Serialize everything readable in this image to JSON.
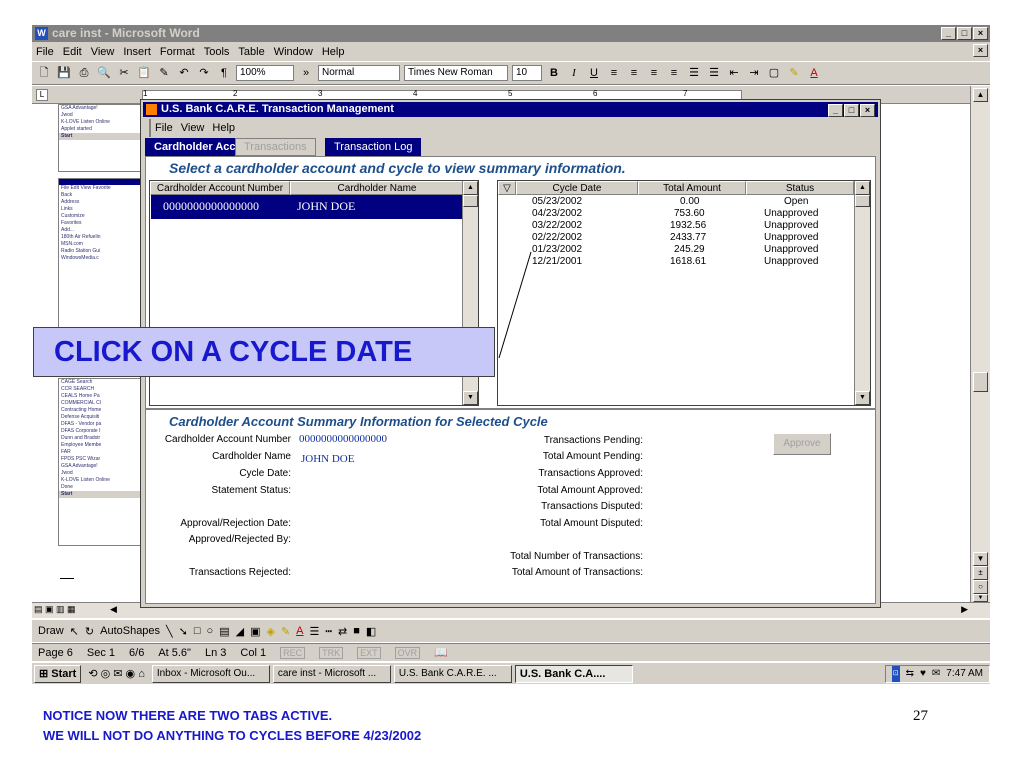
{
  "word": {
    "title": "care inst - Microsoft Word",
    "menu": [
      "File",
      "Edit",
      "View",
      "Insert",
      "Format",
      "Tools",
      "Table",
      "Window",
      "Help"
    ],
    "zoom": "100%",
    "style": "Normal",
    "font": "Times New Roman",
    "font_size": "10",
    "ruler_numbers": [
      "1",
      "2",
      "3",
      "4",
      "5",
      "6",
      "7"
    ],
    "drawbar": {
      "draw": "Draw",
      "autoshapes": "AutoShapes"
    },
    "status": {
      "page": "Page 6",
      "sec": "Sec 1",
      "pages": "6/6",
      "at": "At 5.6\"",
      "ln": "Ln 3",
      "col": "Col 1",
      "rec": "REC",
      "trk": "TRK",
      "ext": "EXT",
      "ovr": "OVR"
    }
  },
  "taskbar": {
    "start": "Start",
    "buttons": [
      "Inbox - Microsoft Ou...",
      "care inst - Microsoft ...",
      "U.S. Bank C.A.R.E. ...",
      "U.S. Bank C.A...."
    ],
    "clock": "7:47 AM"
  },
  "left_thumbs": {
    "top_items": [
      "GSA Advantage!",
      "Jwod",
      "K-LOVE Listen Online",
      "Applet started"
    ],
    "browser_menu": [
      "File",
      "Edit",
      "View",
      "Favorite"
    ],
    "nav": [
      "Back",
      "Address",
      "Links",
      "Customize",
      "Favorites",
      "Add...",
      "Orga"
    ],
    "links": [
      "180th Air Refuelin",
      "MSN.com",
      "Radio Station Gui",
      "WindowsMedia.c"
    ],
    "bottom_items": [
      "CAGE Search",
      "CCR SEARCH",
      "CEALS Home Pa",
      "COMMERCIAL Cl",
      "Contracting Home",
      "Defense Acquisiti",
      "DFAS - Vendor pa",
      "DFAS Corporate I",
      "Dunn and Bradstr",
      "Employee Membe",
      "FAR",
      "FPDS PSC Wizar",
      "GSA Advantage!",
      "Jwod",
      "K-LOVE Listen Online",
      "Done"
    ]
  },
  "app": {
    "title": "U.S. Bank C.A.R.E. Transaction Management",
    "menu": [
      "File",
      "View",
      "Help"
    ],
    "tabs": [
      "Cardholder Accts",
      "Transactions",
      "Transaction Log"
    ],
    "instruction": "Select a cardholder account and cycle to view summary information.",
    "accounts": {
      "headers": [
        "Cardholder Account Number",
        "Cardholder Name"
      ],
      "rows": [
        [
          "0000000000000000",
          "JOHN DOE"
        ]
      ]
    },
    "cycles": {
      "headers": [
        "Cycle Date",
        "Total Amount",
        "Status"
      ],
      "rows": [
        [
          "05/23/2002",
          "0.00",
          "Open"
        ],
        [
          "04/23/2002",
          "753.60",
          "Unapproved"
        ],
        [
          "03/22/2002",
          "1932.56",
          "Unapproved"
        ],
        [
          "02/22/2002",
          "2433.77",
          "Unapproved"
        ],
        [
          "01/23/2002",
          "245.29",
          "Unapproved"
        ],
        [
          "12/21/2001",
          "1618.61",
          "Unapproved"
        ]
      ]
    },
    "summary": {
      "title": "Cardholder Account Summary Information for Selected Cycle",
      "left_labels": [
        "Cardholder Account Number",
        "Cardholder Name",
        "Cycle Date:",
        "Statement Status:",
        "Approval/Rejection Date:",
        "Approved/Rejected By:",
        "Transactions Rejected:"
      ],
      "account_number": "0000000000000000",
      "cardholder_name": "JOHN DOE",
      "right_labels": [
        "Transactions Pending:",
        "Total Amount Pending:",
        "Transactions Approved:",
        "Total Amount Approved:",
        "Transactions Disputed:",
        "Total Amount Disputed:",
        "Total Number of Transactions:",
        "Total Amount of Transactions:"
      ],
      "approve_label": "Approve"
    }
  },
  "callout": "CLICK ON A CYCLE DATE",
  "notes": [
    "NOTICE NOW THERE ARE TWO TABS ACTIVE.",
    "WE WILL NOT DO ANYTHING TO CYCLES BEFORE 4/23/2002"
  ],
  "page_number": "27",
  "colors": {
    "callout_bg": "#c8c8f8",
    "callout_text": "#1818cc",
    "app_title": "#000080",
    "summary_text": "#1e4f8c"
  }
}
